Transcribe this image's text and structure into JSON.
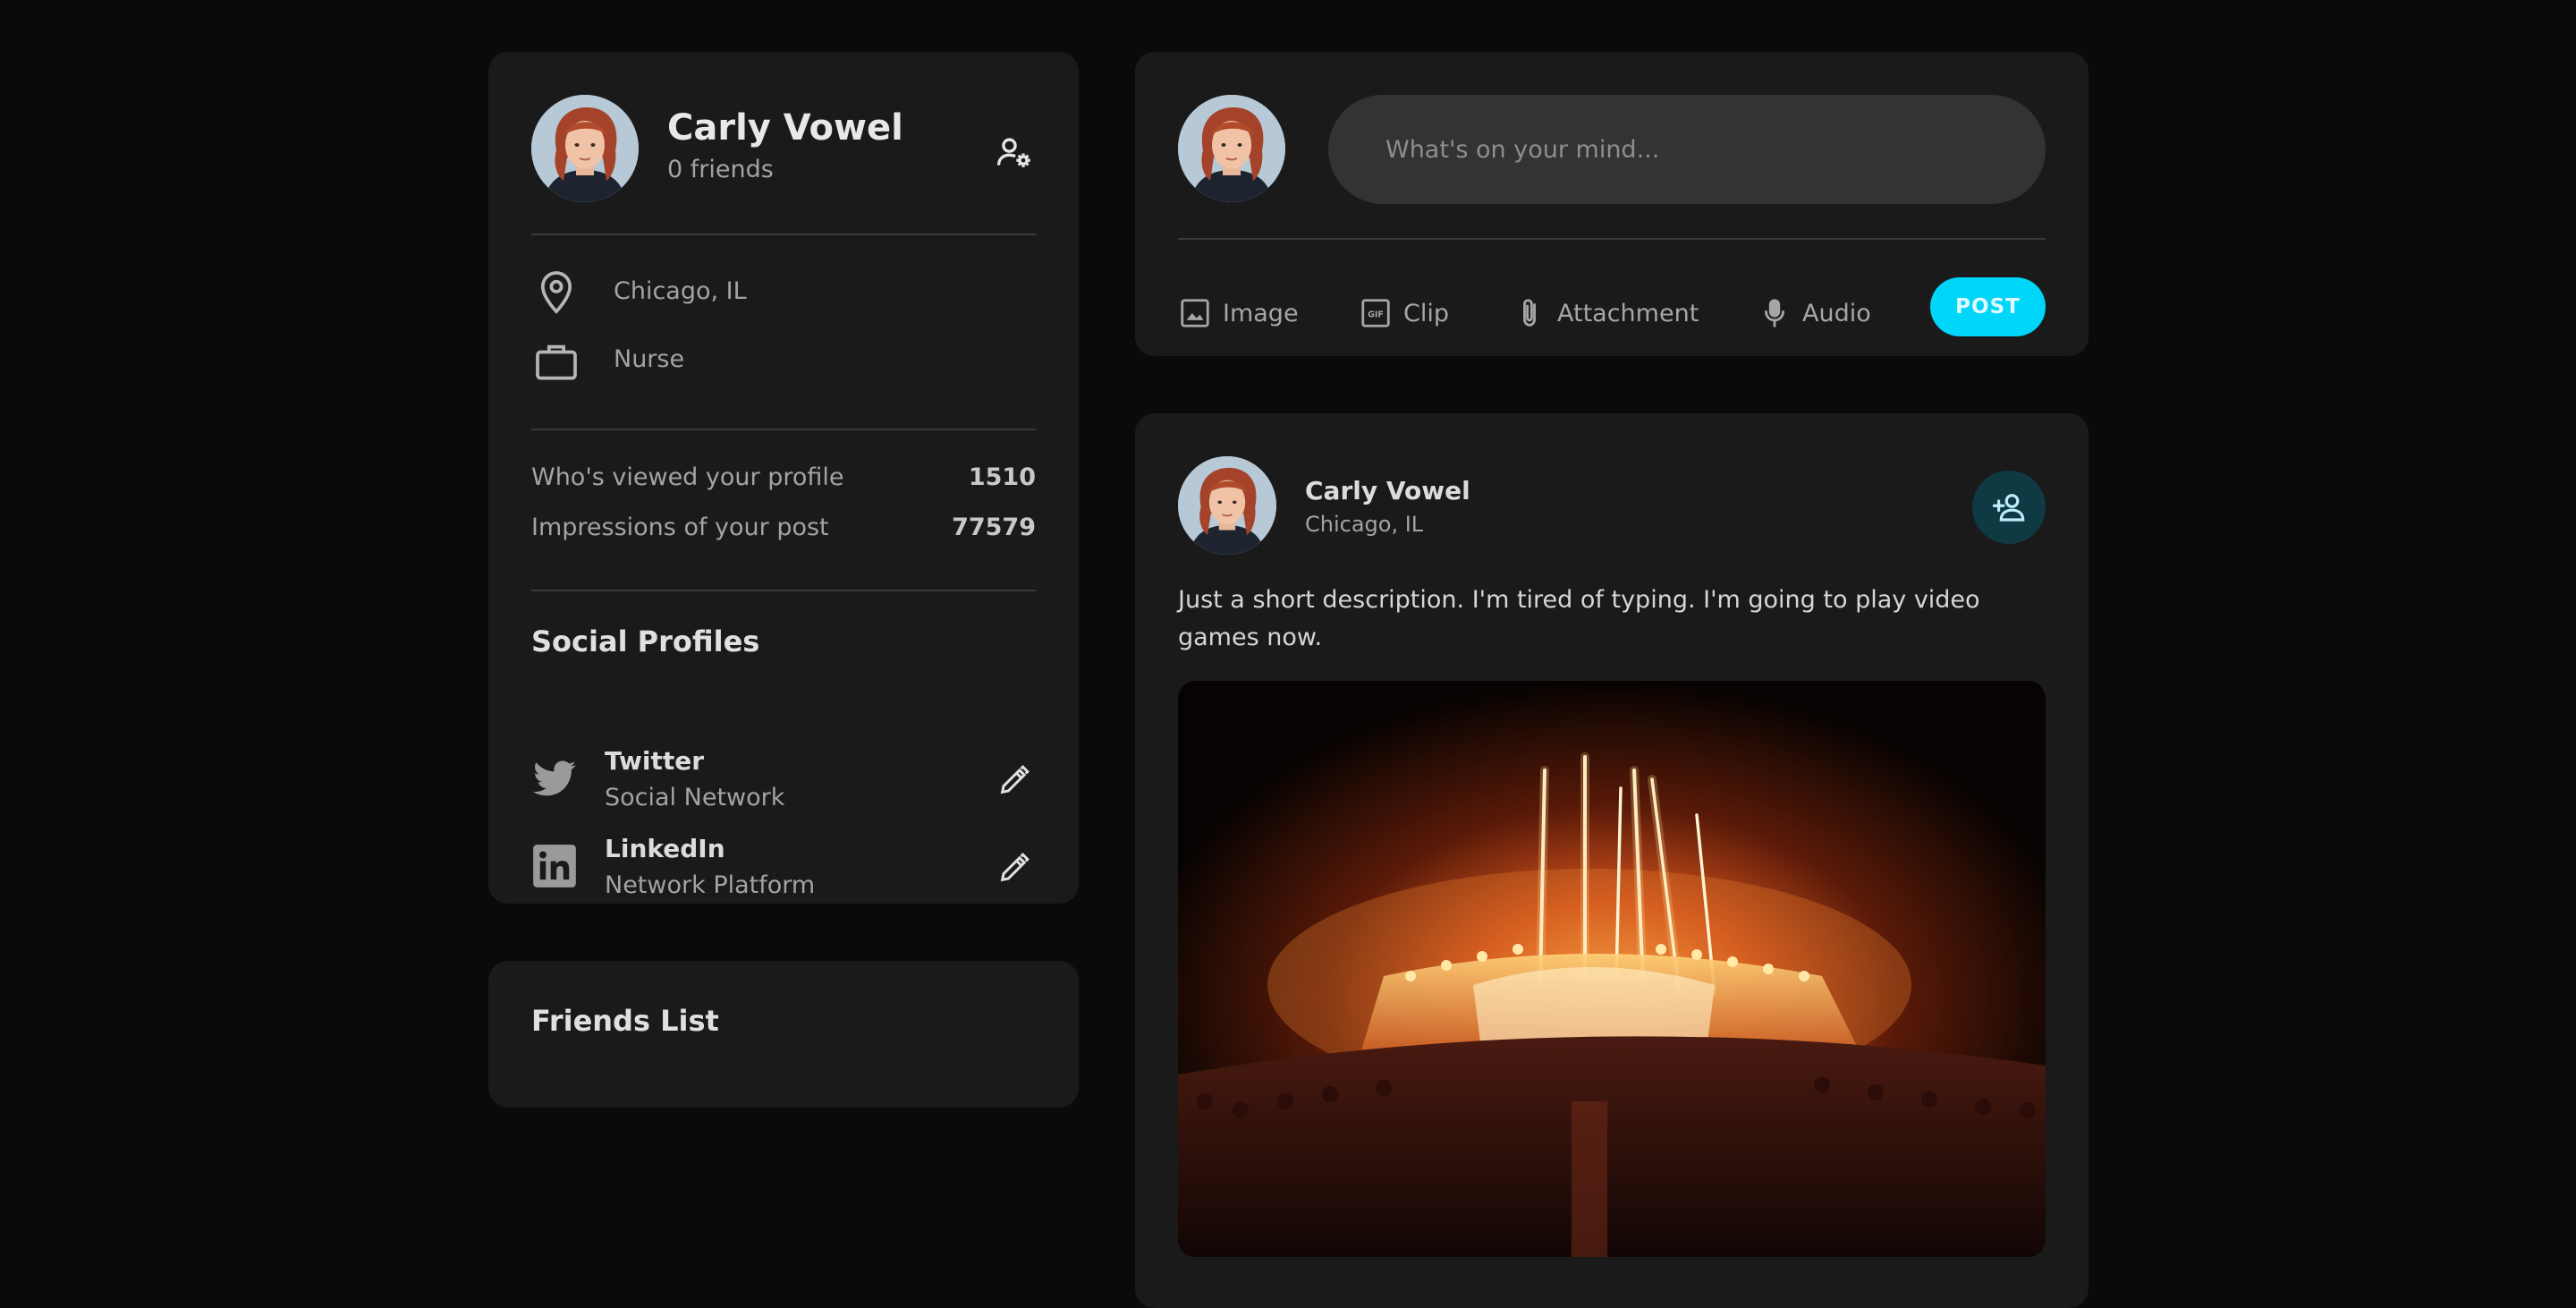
{
  "profile": {
    "name": "Carly Vowel",
    "friends_text": "0 friends",
    "location": "Chicago, IL",
    "occupation": "Nurse",
    "stats": [
      {
        "label": "Who's viewed your profile",
        "value": "1510"
      },
      {
        "label": "Impressions of your post",
        "value": "77579"
      }
    ],
    "social_title": "Social Profiles",
    "social": [
      {
        "name": "Twitter",
        "type": "Social Network",
        "icon": "twitter-icon"
      },
      {
        "name": "LinkedIn",
        "type": "Network Platform",
        "icon": "linkedin-icon"
      }
    ]
  },
  "friends_list": {
    "title": "Friends List"
  },
  "composer": {
    "placeholder": "What's on your mind...",
    "tools": [
      {
        "label": "Image",
        "icon": "image-icon"
      },
      {
        "label": "Clip",
        "icon": "gif-icon"
      },
      {
        "label": "Attachment",
        "icon": "paperclip-icon"
      },
      {
        "label": "Audio",
        "icon": "microphone-icon"
      }
    ],
    "post_label": "POST"
  },
  "post": {
    "author": "Carly Vowel",
    "location": "Chicago, IL",
    "description": "Just a short description. I'm tired of typing. I'm going to play video games now.",
    "image_subject": "concert-stage-fireworks"
  },
  "colors": {
    "background": "#0a0a0a",
    "card": "#1a1a1a",
    "accent": "#00d5fa",
    "input": "#333333",
    "add_friend_bg": "#0f3a44"
  }
}
